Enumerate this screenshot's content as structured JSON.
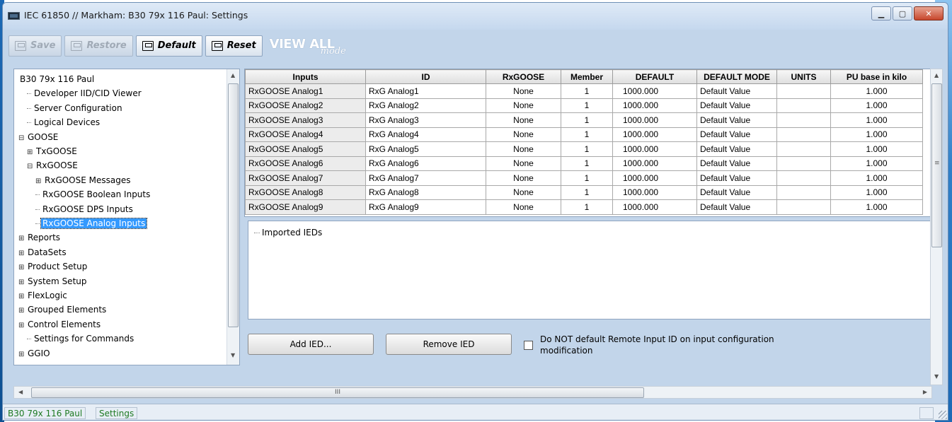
{
  "window": {
    "title": "IEC 61850 // Markham: B30 79x 116 Paul: Settings",
    "buttons": [
      "minimize",
      "maximize",
      "close"
    ]
  },
  "toolbar": {
    "save": "Save",
    "restore": "Restore",
    "default": "Default",
    "reset": "Reset",
    "view_all": "VIEW ALL",
    "mode": "mode"
  },
  "tree": {
    "items": [
      {
        "label": "B30 79x 116 Paul",
        "level": 0,
        "expander": "",
        "selected": false
      },
      {
        "label": "Developer IID/CID Viewer",
        "level": 1,
        "expander": "",
        "selected": false
      },
      {
        "label": "Server Configuration",
        "level": 1,
        "expander": "",
        "selected": false
      },
      {
        "label": "Logical Devices",
        "level": 1,
        "expander": "",
        "selected": false
      },
      {
        "label": "GOOSE",
        "level": 0,
        "expander": "⊟",
        "selected": false
      },
      {
        "label": "TxGOOSE",
        "level": 1,
        "expander": "⊞",
        "selected": false
      },
      {
        "label": "RxGOOSE",
        "level": 1,
        "expander": "⊟",
        "selected": false
      },
      {
        "label": "RxGOOSE Messages",
        "level": 2,
        "expander": "⊞",
        "selected": false
      },
      {
        "label": "RxGOOSE Boolean Inputs",
        "level": 2,
        "expander": "",
        "selected": false
      },
      {
        "label": "RxGOOSE DPS Inputs",
        "level": 2,
        "expander": "",
        "selected": false
      },
      {
        "label": "RxGOOSE Analog Inputs",
        "level": 2,
        "expander": "",
        "selected": true
      },
      {
        "label": "Reports",
        "level": 0,
        "expander": "⊞",
        "selected": false
      },
      {
        "label": "DataSets",
        "level": 0,
        "expander": "⊞",
        "selected": false
      },
      {
        "label": "Product Setup",
        "level": 0,
        "expander": "⊞",
        "selected": false
      },
      {
        "label": "System Setup",
        "level": 0,
        "expander": "⊞",
        "selected": false
      },
      {
        "label": "FlexLogic",
        "level": 0,
        "expander": "⊞",
        "selected": false
      },
      {
        "label": "Grouped Elements",
        "level": 0,
        "expander": "⊞",
        "selected": false
      },
      {
        "label": "Control Elements",
        "level": 0,
        "expander": "⊞",
        "selected": false
      },
      {
        "label": "Settings for Commands",
        "level": 1,
        "expander": "",
        "selected": false
      },
      {
        "label": "GGIO",
        "level": 0,
        "expander": "⊞",
        "selected": false
      }
    ]
  },
  "table": {
    "headers": [
      "Inputs",
      "ID",
      "RxGOOSE",
      "Member",
      "DEFAULT",
      "DEFAULT MODE",
      "UNITS",
      "PU base in kilo"
    ],
    "rows": [
      [
        "RxGOOSE Analog1",
        "RxG Analog1",
        "None",
        "1",
        "1000.000",
        "Default Value",
        "",
        "1.000"
      ],
      [
        "RxGOOSE Analog2",
        "RxG Analog2",
        "None",
        "1",
        "1000.000",
        "Default Value",
        "",
        "1.000"
      ],
      [
        "RxGOOSE Analog3",
        "RxG Analog3",
        "None",
        "1",
        "1000.000",
        "Default Value",
        "",
        "1.000"
      ],
      [
        "RxGOOSE Analog4",
        "RxG Analog4",
        "None",
        "1",
        "1000.000",
        "Default Value",
        "",
        "1.000"
      ],
      [
        "RxGOOSE Analog5",
        "RxG Analog5",
        "None",
        "1",
        "1000.000",
        "Default Value",
        "",
        "1.000"
      ],
      [
        "RxGOOSE Analog6",
        "RxG Analog6",
        "None",
        "1",
        "1000.000",
        "Default Value",
        "",
        "1.000"
      ],
      [
        "RxGOOSE Analog7",
        "RxG Analog7",
        "None",
        "1",
        "1000.000",
        "Default Value",
        "",
        "1.000"
      ],
      [
        "RxGOOSE Analog8",
        "RxG Analog8",
        "None",
        "1",
        "1000.000",
        "Default Value",
        "",
        "1.000"
      ],
      [
        "RxGOOSE Analog9",
        "RxG Analog9",
        "None",
        "1",
        "1000.000",
        "Default Value",
        "",
        "1.000"
      ]
    ]
  },
  "imported": {
    "label": "Imported IEDs"
  },
  "actions": {
    "add_ied": "Add IED...",
    "remove_ied": "Remove IED",
    "checkbox_label": "Do NOT default Remote Input ID on input configuration modification",
    "checkbox_checked": false
  },
  "hscroll": {
    "grip": "III"
  },
  "status": {
    "device": "B30 79x 116 Paul",
    "mode": "Settings"
  }
}
